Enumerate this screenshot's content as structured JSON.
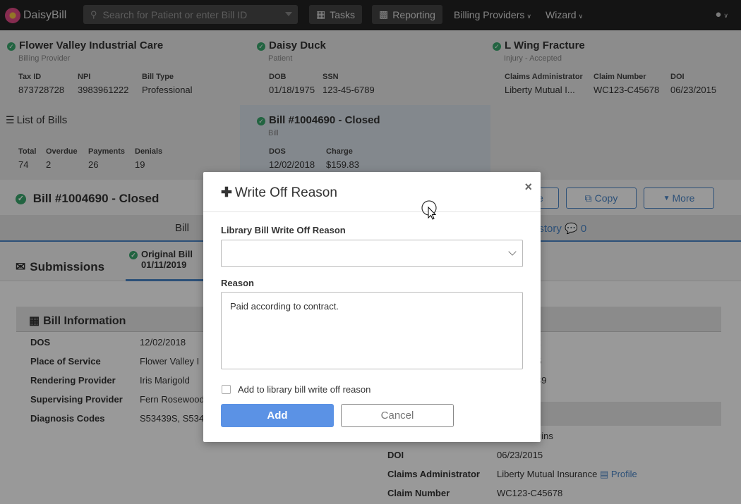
{
  "navbar": {
    "brand": "DaisyBill",
    "search_placeholder": "Search for Patient or enter Bill ID",
    "tasks": "Tasks",
    "reporting": "Reporting",
    "billing_providers": "Billing Providers",
    "wizard": "Wizard"
  },
  "crumbs": {
    "provider": {
      "title": "Flower Valley Industrial Care",
      "sub": "Billing Provider",
      "fields": [
        {
          "k": "Tax ID",
          "v": "873728728"
        },
        {
          "k": "NPI",
          "v": "3983961222"
        },
        {
          "k": "Bill Type",
          "v": "Professional"
        }
      ]
    },
    "patient": {
      "title": "Daisy Duck",
      "sub": "Patient",
      "fields": [
        {
          "k": "DOB",
          "v": "01/18/1975"
        },
        {
          "k": "SSN",
          "v": "123-45-6789"
        }
      ]
    },
    "injury": {
      "title": "L Wing Fracture",
      "sub": "Injury - Accepted",
      "fields": [
        {
          "k": "Claims Administrator",
          "v": "Liberty Mutual I..."
        },
        {
          "k": "Claim Number",
          "v": "WC123-C45678"
        },
        {
          "k": "DOI",
          "v": "06/23/2015"
        }
      ]
    },
    "bills": {
      "title": "List of Bills",
      "fields": [
        {
          "k": "Total",
          "v": "74"
        },
        {
          "k": "Overdue",
          "v": "2"
        },
        {
          "k": "Payments",
          "v": "26"
        },
        {
          "k": "Denials",
          "v": "19"
        }
      ]
    },
    "bill": {
      "title": "Bill #1004690 - Closed",
      "sub": "Bill",
      "fields": [
        {
          "k": "DOS",
          "v": "12/02/2018"
        },
        {
          "k": "Charge",
          "v": "$159.83"
        }
      ]
    }
  },
  "bill_header": {
    "title": "Bill #1004690 - Closed",
    "btn_partial": "e",
    "btn_copy": "Copy",
    "btn_more": "More"
  },
  "tabs": {
    "bill": "Bill",
    "history": "istory",
    "history_count": "0"
  },
  "submissions": {
    "label": "Submissions",
    "original_bill": "Original Bill",
    "original_date": "01/11/2019"
  },
  "bill_info": {
    "title": "Bill Information",
    "rows": [
      {
        "k": "DOS",
        "v": "12/02/2018"
      },
      {
        "k": "Place of Service",
        "v": "Flower Valley I"
      },
      {
        "k": "Rendering Provider",
        "v": "Iris Marigold"
      },
      {
        "k": "Supervising Provider",
        "v": "Fern Rosewood"
      },
      {
        "k": "Diagnosis Codes",
        "v": "S53439S, S534"
      }
    ],
    "right_partial": [
      "k",
      "5",
      "89"
    ]
  },
  "claim_info": {
    "partial": "gins",
    "rows": [
      {
        "k": "DOI",
        "v": "06/23/2015"
      },
      {
        "k": "Claims Administrator",
        "v": "Liberty Mutual Insurance"
      },
      {
        "k": "Claim Number",
        "v": "WC123-C45678"
      }
    ],
    "profile_link": "Profile"
  },
  "modal": {
    "title": "Write Off Reason",
    "library_label": "Library Bill Write Off Reason",
    "library_value": "",
    "reason_label": "Reason",
    "reason_value": "Paid according to contract.",
    "checkbox_label": "Add to library bill write off reason",
    "checkbox_checked": false,
    "add_label": "Add",
    "cancel_label": "Cancel"
  }
}
